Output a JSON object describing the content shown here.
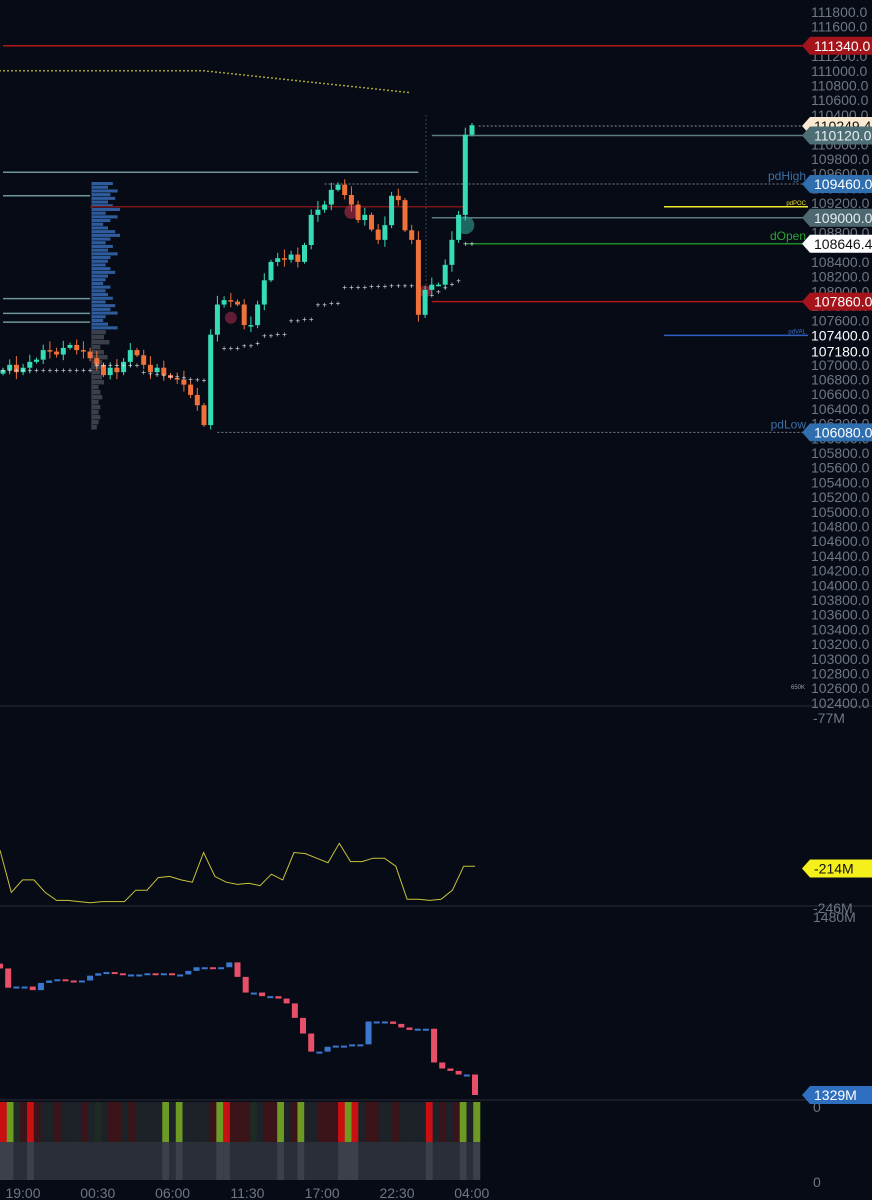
{
  "chart_data": {
    "type": "candlestick",
    "price_axis": {
      "min": 102400,
      "max": 111800,
      "step": 200,
      "highlighted": [
        "107400.0",
        "107180.0"
      ]
    },
    "time_labels": [
      "19:00",
      "00:30",
      "06:00",
      "11:30",
      "17:00",
      "22:30",
      "04:00"
    ],
    "closes": [
      106930,
      107000,
      106900,
      106960,
      107040,
      107070,
      107200,
      107180,
      107140,
      107230,
      107270,
      107200,
      107180,
      107090,
      107000,
      106860,
      106960,
      106900,
      107040,
      107200,
      107130,
      107000,
      106900,
      106960,
      106860,
      106820,
      106800,
      106730,
      106590,
      106450,
      106180,
      107410,
      107820,
      107880,
      107860,
      107820,
      107540,
      107540,
      107820,
      108150,
      108400,
      108450,
      108430,
      108500,
      108400,
      108630,
      109040,
      109110,
      109180,
      109380,
      109450,
      109310,
      109180,
      108970,
      109040,
      108840,
      108700,
      108900,
      109300,
      109240,
      108830,
      108700,
      107680,
      108020,
      108090,
      108090,
      108360,
      108700,
      109040,
      110130,
      110260
    ],
    "trail": [
      106930,
      106930,
      106930,
      106930,
      106930,
      106930,
      106930,
      106930,
      106930,
      106930,
      106930,
      106930,
      106930,
      106930,
      107000,
      107000,
      107000,
      107000,
      107000,
      107000,
      107000,
      106900,
      106880,
      106870,
      106860,
      106850,
      106840,
      106830,
      106810,
      106800,
      106790,
      null,
      null,
      107230,
      107230,
      107230,
      107260,
      107260,
      107300,
      107400,
      107400,
      107420,
      107420,
      107600,
      107600,
      107620,
      107620,
      107820,
      107820,
      107840,
      107840,
      108060,
      108060,
      108060,
      108060,
      108070,
      108070,
      108070,
      108080,
      108080,
      108080,
      108080,
      null,
      null,
      107950,
      108000,
      108050,
      108100,
      108150,
      108650,
      108650
    ],
    "vwap": {
      "start": 111000,
      "flat_until_index": 30,
      "end": 110700,
      "end_index": 61
    },
    "volume_profile": [
      0.7,
      0.5,
      0.9,
      0.6,
      0.8,
      0.5,
      0.7,
      1.0,
      0.4,
      0.9,
      0.6,
      0.3,
      0.5,
      0.8,
      1.0,
      0.6,
      0.4,
      0.7,
      0.5,
      0.9,
      0.6,
      0.5,
      0.4,
      0.6,
      0.8,
      0.5,
      0.4,
      0.3,
      0.6,
      0.4,
      0.5,
      0.7,
      0.4,
      0.8,
      0.6,
      0.9,
      0.4,
      0.3,
      0.5,
      0.9
    ],
    "volume_profile_low": [
      0.6,
      0.5,
      0.8,
      0.3,
      0.5,
      0.7,
      0.4,
      0.6,
      0.3,
      0.4,
      0.5,
      0.2,
      0.3,
      0.4,
      0.2,
      0.3,
      0.2,
      0.3,
      0.2,
      0.1
    ],
    "levels": [
      {
        "price": 111340,
        "color": "#b3171c",
        "from": 0,
        "style": "solid",
        "label": "",
        "badge": "111340.0",
        "badge_bg": "#a5141a",
        "badge_fg": "#ffffff"
      },
      {
        "price": 110249.4,
        "color": "#8a9196",
        "from": 71,
        "style": "dotted",
        "label": "",
        "badge": "110249.4",
        "badge_bg": "#fbead2",
        "badge_fg": "#111111"
      },
      {
        "price": 110120,
        "color": "#5d7c82",
        "from": 64,
        "style": "solid",
        "label": "",
        "badge": "110120.0",
        "badge_bg": "#4d6e74",
        "badge_fg": "#e6eef0"
      },
      {
        "price": 109620,
        "color": "#6f959b",
        "from": 0,
        "to": 62,
        "style": "solid",
        "label": "",
        "badge": ""
      },
      {
        "price": 109460,
        "color": "#7a8288",
        "from": 48,
        "style": "dotted",
        "label": "pdHigh",
        "label_color": "#3f6fa3",
        "badge": "109460.0",
        "badge_bg": "#2f6fb0",
        "badge_fg": "#ffffff"
      },
      {
        "price": 109300,
        "color": "#6f959b",
        "from": 0,
        "to": 13,
        "style": "solid",
        "label": "",
        "badge": ""
      },
      {
        "price": 109150,
        "color": "#7a1418",
        "from": 13,
        "to": 69,
        "style": "solid",
        "label": "",
        "badge": ""
      },
      {
        "price": 109150,
        "color": "#f2ea2a",
        "from": 99,
        "style": "solid",
        "label": "pdPOC",
        "label_color": "#e8e02a",
        "small": true,
        "badge": ""
      },
      {
        "price": 109000,
        "color": "#5d7c82",
        "from": 64,
        "style": "solid",
        "label": "",
        "badge": "109000.0",
        "badge_bg": "#4d6870",
        "badge_fg": "#e6eef0"
      },
      {
        "price": 108646.4,
        "color": "#1e8b2a",
        "from": 69,
        "style": "solid",
        "label": "dOpen",
        "label_color": "#2aa634",
        "badge": "108646.4",
        "badge_bg": "#ffffff",
        "badge_fg": "#111111"
      },
      {
        "price": 107860,
        "color": "#b3171c",
        "from": 64,
        "style": "solid",
        "label": "",
        "badge": "107860.0",
        "badge_bg": "#a5141a",
        "badge_fg": "#ffffff"
      },
      {
        "price": 107900,
        "color": "#6f959b",
        "from": 0,
        "to": 13,
        "style": "solid",
        "label": "",
        "badge": ""
      },
      {
        "price": 107700,
        "color": "#6f959b",
        "from": 0,
        "to": 13,
        "style": "solid",
        "label": "",
        "badge": ""
      },
      {
        "price": 107580,
        "color": "#6f959b",
        "from": 0,
        "to": 13,
        "style": "solid",
        "label": "",
        "badge": ""
      },
      {
        "price": 107400,
        "color": "#2f5fc0",
        "from": 99,
        "style": "solid",
        "label": "pdVAL",
        "label_color": "#3f6fc3",
        "small": true,
        "badge": ""
      },
      {
        "price": 106080,
        "color": "#7a8288",
        "from": 32,
        "style": "dotted",
        "label": "pdLow",
        "label_color": "#3f6fa3",
        "badge": "106080.0",
        "badge_bg": "#2f6fb0",
        "badge_fg": "#ffffff"
      }
    ],
    "annotations": {
      "volume_note": "650K"
    },
    "oscillator": {
      "axis_top": "-77M",
      "axis_bottom": "-246M",
      "min": -246,
      "max": -77,
      "current_badge": "-214M",
      "color": "#c9c43a",
      "values": [
        -198,
        -235,
        -224,
        -224,
        -235,
        -242,
        -242,
        -243,
        -244,
        -243,
        -243,
        -243,
        -233,
        -233,
        -222,
        -221,
        -224,
        -226,
        -200,
        -221,
        -226,
        -228,
        -227,
        -229,
        -219,
        -224,
        -200,
        -201,
        -205,
        -209,
        -192,
        -208,
        -208,
        -205,
        -205,
        -212,
        -241,
        -241,
        -242,
        -241,
        -233,
        -212,
        -212
      ]
    },
    "cvd": {
      "axis_top": "1480M",
      "axis_zero": "0",
      "current_badge": "1329M",
      "min": 1329,
      "max": 1480,
      "up_color": "#3a78d0",
      "down_color": "#e8506a",
      "values": [
        1434,
        1418,
        1419,
        1419,
        1416,
        1422,
        1424,
        1425,
        1424,
        1423,
        1424,
        1428,
        1430,
        1431,
        1430,
        1429,
        1429,
        1429,
        1430,
        1429,
        1430,
        1429,
        1429,
        1432,
        1435,
        1435,
        1434,
        1435,
        1439,
        1427,
        1414,
        1414,
        1411,
        1411,
        1409,
        1405,
        1393,
        1380,
        1365,
        1365,
        1369,
        1370,
        1370,
        1371,
        1371,
        1390,
        1390,
        1390,
        1388,
        1385,
        1383,
        1384,
        1384,
        1356,
        1351,
        1349,
        1346,
        1346,
        1329
      ]
    },
    "heat_axis": "0",
    "heat": "RGgrRrnnrnnnrngnrrnrnnnnGnGnnnnrGRrrrgnrrGnrGnnrrrRGRnrrnnrnnnnRnrnrGnG"
  }
}
